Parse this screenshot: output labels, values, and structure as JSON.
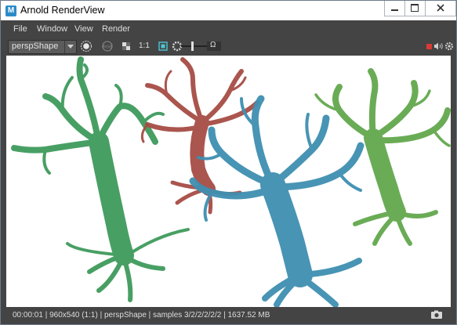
{
  "window": {
    "title": "Arnold RenderView",
    "app_icon_letter": "M"
  },
  "menu": [
    "File",
    "Window",
    "View",
    "Render"
  ],
  "toolbar": {
    "camera": "perspShape",
    "aspect_label": "1:1",
    "gamma_label": "Ω"
  },
  "status": {
    "text": "00:00:01 | 960x540 (1:1) | perspShape  | samples 3/2/2/2/2/2 | 1637.52 MB"
  },
  "colors": {
    "tree_green_left": "#3f9a5c",
    "tree_red": "#a64c45",
    "tree_blue": "#3f8fb1",
    "tree_green_right": "#5ea548",
    "record_button": "#d83b34"
  },
  "icons": [
    "app-icon",
    "minimize-icon",
    "maximize-icon",
    "close-icon",
    "dropdown-arrow-icon",
    "render-start-icon",
    "exposure-icon",
    "checker-icon",
    "crop-region-icon",
    "gear-icon",
    "record-icon",
    "audio-icon",
    "settings-icon",
    "snapshot-icon"
  ]
}
